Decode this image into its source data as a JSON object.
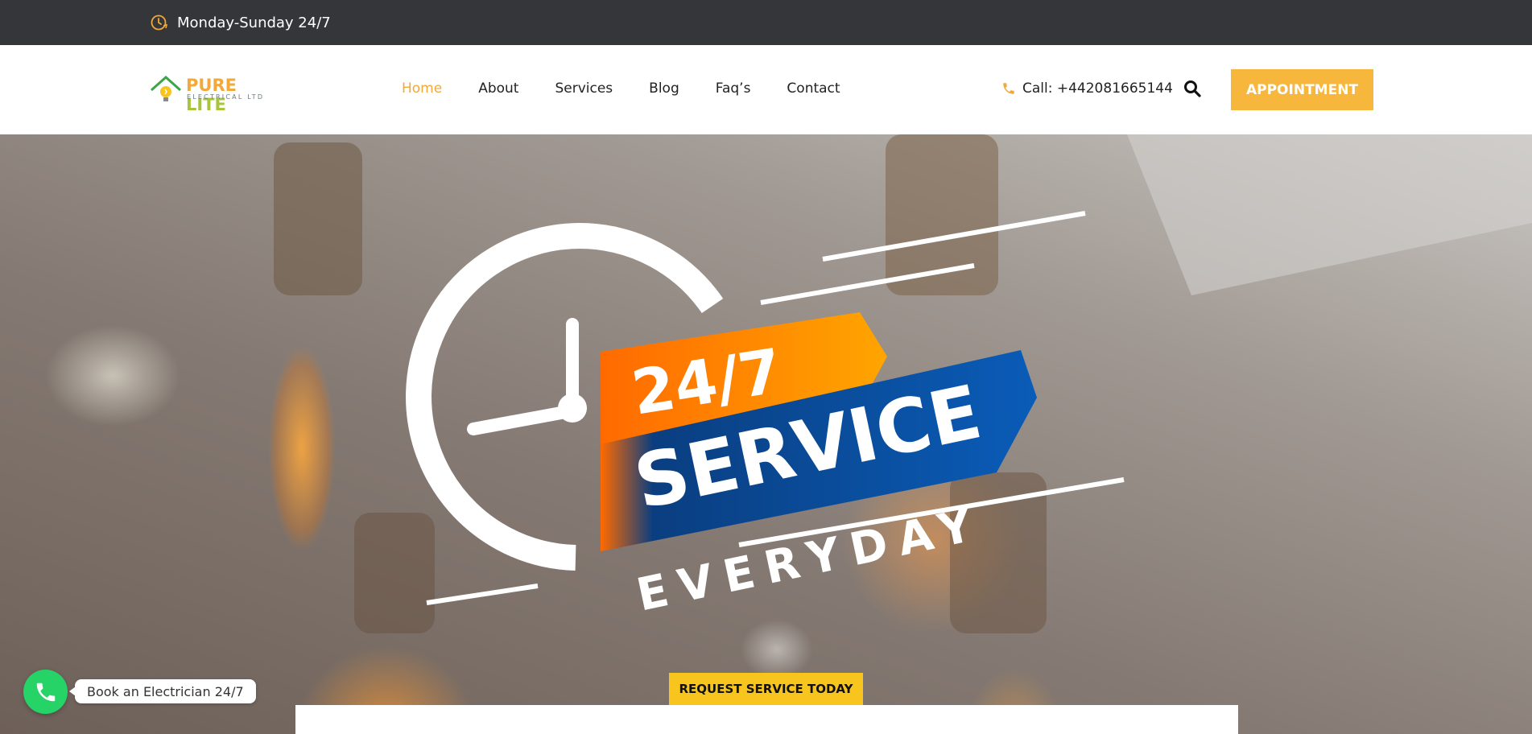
{
  "topbar": {
    "hours": "Monday-Sunday 24/7",
    "icon": "clock-icon",
    "icon_color": "#f2a93b"
  },
  "header": {
    "logo": {
      "brand_part1": "PURE",
      "brand_part2": "LITE",
      "subtitle": "ELECTRICAL LTD"
    },
    "nav": [
      {
        "label": "Home",
        "active": true
      },
      {
        "label": "About",
        "active": false
      },
      {
        "label": "Services",
        "active": false
      },
      {
        "label": "Blog",
        "active": false
      },
      {
        "label": "Faq’s",
        "active": false
      },
      {
        "label": "Contact",
        "active": false
      }
    ],
    "call_label": "Call: +442081665144",
    "call_icon": "phone-icon",
    "search_icon": "search-icon",
    "appointment_label": "APPOINTMENT"
  },
  "hero": {
    "line1": "24/7",
    "line2": "SERVICE",
    "line3": "EVERYDAY",
    "cta_label": "REQUEST SERVICE TODAY"
  },
  "whatsapp": {
    "icon": "whatsapp-phone-icon",
    "label": "Book an Electrician 24/7"
  },
  "colors": {
    "accent": "#f7b63c",
    "cta_yellow": "#f7c51e",
    "topbar_bg": "#35363a",
    "orange_band": "#ff7a00",
    "blue_band": "#0a4fa0",
    "whatsapp_green": "#25d366"
  }
}
